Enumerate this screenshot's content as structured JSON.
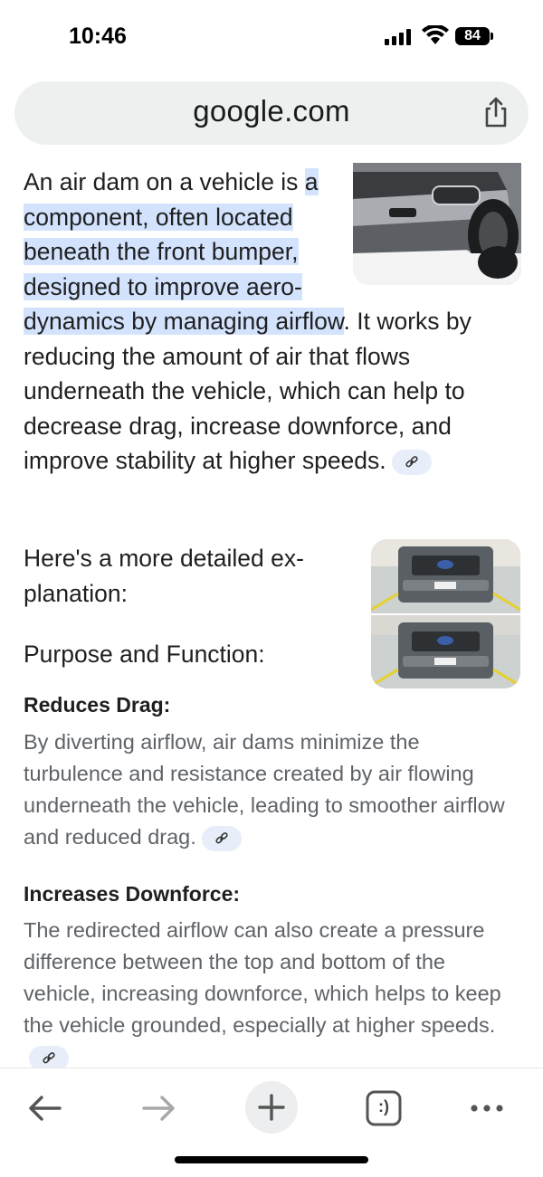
{
  "status_bar": {
    "time": "10:46",
    "battery": "84"
  },
  "browser": {
    "url": "google.com",
    "share_icon": "share-icon"
  },
  "content": {
    "intro_prefix": "An air dam on a vehicle is ",
    "intro_highlight": "a component, often located beneath the front bumper, designed to improve aero-dynamics by managing airflow",
    "intro_suffix": ". It works by reducing the amount of air that flows underneath the vehicle, which can help to decrease drag, increase downforce, and improve stability at higher speeds.",
    "detail_intro": "Here's a more detailed ex-planation:",
    "purpose_heading": "Purpose and Function:",
    "sections": [
      {
        "title": "Reduces Drag:",
        "body": "By diverting airflow, air dams minimize the turbulence and resistance created by air flowing underneath the vehicle, leading to smoother airflow and reduced drag."
      },
      {
        "title": "Increases Downforce:",
        "body": "The redirected airflow can also create a pressure difference between the top and bottom of the vehicle, increasing downforce, which helps to keep the vehicle grounded, especially at higher speeds."
      }
    ]
  },
  "toolbar": {
    "back_icon": "arrow-left-icon",
    "forward_icon": "arrow-right-icon",
    "new_tab_icon": "plus-icon",
    "tabs_icon": "tabs-icon",
    "tabs_label": ":)",
    "more_icon": "more-dots-icon"
  },
  "colors": {
    "highlight": "#d3e3fd",
    "link_chip": "#e8eef9",
    "url_bar": "#eef0f0",
    "secondary_text": "#5f6368"
  }
}
